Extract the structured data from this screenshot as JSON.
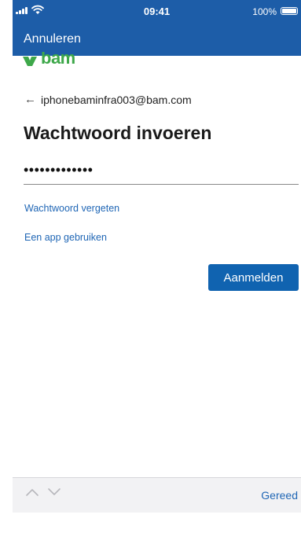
{
  "status_bar": {
    "time": "09:41",
    "battery": "100%"
  },
  "nav": {
    "cancel_label": "Annuleren"
  },
  "brand": {
    "logo_text": "bam",
    "color": "#3ea84a"
  },
  "account": {
    "email": "iphonebaminfra003@bam.com",
    "back_icon": "arrow-left-icon"
  },
  "form": {
    "title": "Wachtwoord invoeren",
    "password_mask": "•••••••••••••",
    "forgot_link": "Wachtwoord vergeten",
    "use_app_link": "Een app gebruiken",
    "submit_label": "Aanmelden"
  },
  "keyboard_toolbar": {
    "prev_icon": "chevron-up-icon",
    "next_icon": "chevron-down-icon",
    "done_label": "Gereed"
  },
  "colors": {
    "header_bg": "#1d5da8",
    "link": "#1f66b5",
    "button_bg": "#1063b0"
  }
}
